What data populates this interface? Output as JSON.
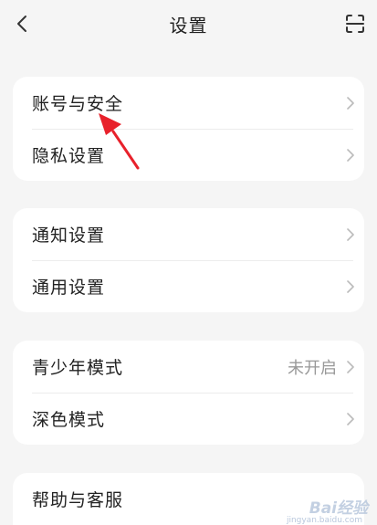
{
  "header": {
    "title": "设置"
  },
  "sections": [
    {
      "items": [
        {
          "label": "账号与安全"
        },
        {
          "label": "隐私设置"
        }
      ]
    },
    {
      "items": [
        {
          "label": "通知设置"
        },
        {
          "label": "通用设置"
        }
      ]
    },
    {
      "items": [
        {
          "label": "青少年模式",
          "value": "未开启"
        },
        {
          "label": "深色模式"
        }
      ]
    },
    {
      "items": [
        {
          "label": "帮助与客服"
        }
      ]
    }
  ],
  "annotation": {
    "arrow_color": "#e8212b"
  },
  "watermark": {
    "text": "Bai经验",
    "sub": "jingyan.baidu.com"
  },
  "icons": {
    "back": "chevron-left-icon",
    "scan": "scan-icon",
    "row_arrow": "chevron-right-icon"
  }
}
